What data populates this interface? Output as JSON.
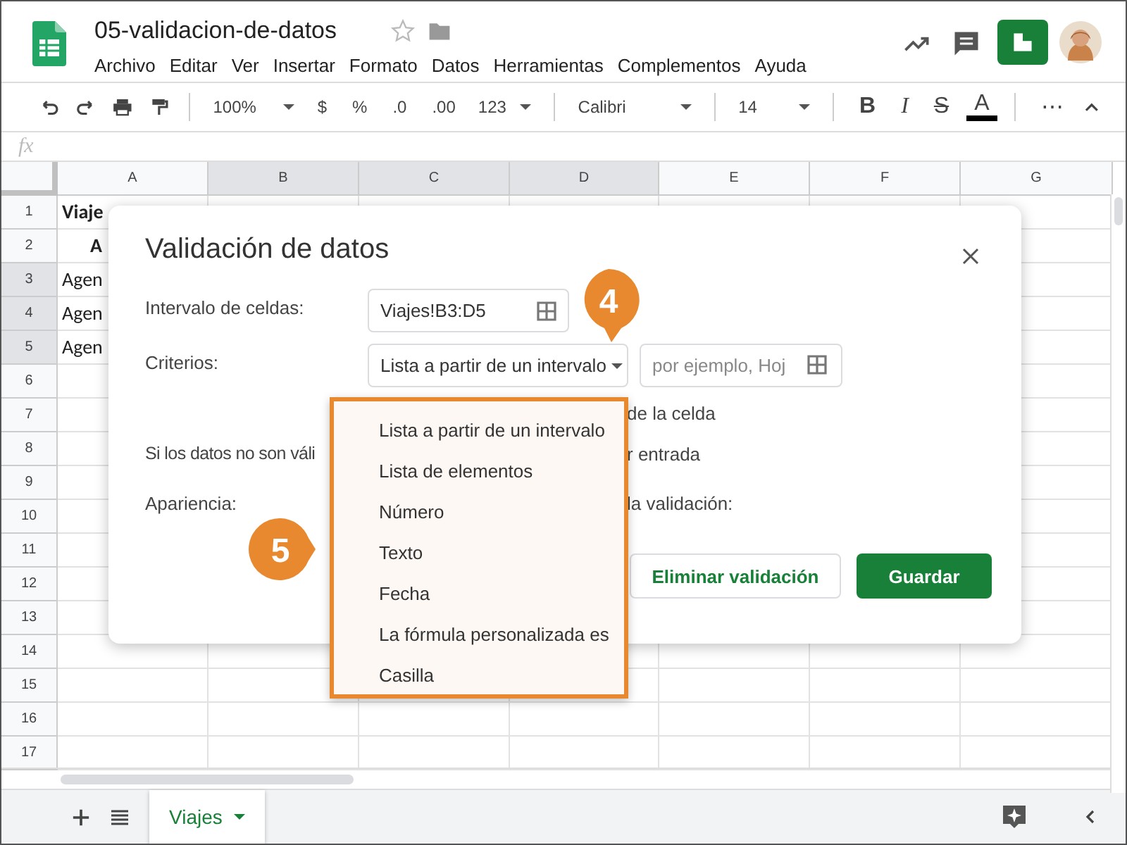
{
  "document": {
    "title": "05-validacion-de-datos"
  },
  "menu": [
    "Archivo",
    "Editar",
    "Ver",
    "Insertar",
    "Formato",
    "Datos",
    "Herramientas",
    "Complementos",
    "Ayuda"
  ],
  "toolbar": {
    "zoom": "100%",
    "currency": "$",
    "percent": "%",
    "decrease_decimals": ".0",
    "increase_decimals": ".00",
    "number_format": "123",
    "font": "Calibri",
    "font_size": "14",
    "bold": "B",
    "italic": "I",
    "strikethrough": "S",
    "text_color": "A",
    "more": "⋯"
  },
  "formula_bar": {
    "fx": "fx"
  },
  "columns": [
    {
      "label": "A",
      "selected": false
    },
    {
      "label": "B",
      "selected": true
    },
    {
      "label": "C",
      "selected": true
    },
    {
      "label": "D",
      "selected": true
    },
    {
      "label": "E",
      "selected": false
    },
    {
      "label": "F",
      "selected": false
    },
    {
      "label": "G",
      "selected": false
    }
  ],
  "rows": [
    {
      "number": "1",
      "selected": false,
      "cell_a": {
        "text": "Viaje",
        "kind": "title"
      }
    },
    {
      "number": "2",
      "selected": false,
      "cell_a": {
        "text": "A",
        "kind": "header"
      }
    },
    {
      "number": "3",
      "selected": true,
      "cell_a": {
        "text": "Agen",
        "kind": "data"
      }
    },
    {
      "number": "4",
      "selected": true,
      "cell_a": {
        "text": "Agen",
        "kind": "data"
      }
    },
    {
      "number": "5",
      "selected": true,
      "cell_a": {
        "text": "Agen",
        "kind": "data"
      }
    },
    {
      "number": "6",
      "selected": false
    },
    {
      "number": "7",
      "selected": false
    },
    {
      "number": "8",
      "selected": false
    },
    {
      "number": "9",
      "selected": false
    },
    {
      "number": "10",
      "selected": false
    },
    {
      "number": "11",
      "selected": false
    },
    {
      "number": "12",
      "selected": false
    },
    {
      "number": "13",
      "selected": false
    },
    {
      "number": "14",
      "selected": false
    },
    {
      "number": "15",
      "selected": false
    },
    {
      "number": "16",
      "selected": false
    },
    {
      "number": "17",
      "selected": false
    }
  ],
  "dialog": {
    "title": "Validación de datos",
    "range_label": "Intervalo de celdas:",
    "range_value": "Viajes!B3:D5",
    "criteria_label": "Criterios:",
    "criteria_value": "Lista a partir de un intervalo",
    "criteria_source_placeholder": "por ejemplo, Hoj",
    "show_list_fragment": "de la celda",
    "invalid_label": "Si los datos no son váli",
    "invalid_option_fragment": "r entrada",
    "appearance_label": "Apariencia:",
    "appearance_option_fragment": "la validación:",
    "buttons": [
      {
        "label": "Eliminar validación",
        "kind": "secondary"
      },
      {
        "label": "Guardar",
        "kind": "primary"
      }
    ]
  },
  "criteria_menu": [
    "Lista a partir de un intervalo",
    "Lista de elementos",
    "Número",
    "Texto",
    "Fecha",
    "La fórmula personalizada es",
    "Casilla"
  ],
  "callouts": [
    {
      "number": "4",
      "kind": "down"
    },
    {
      "number": "5",
      "kind": "right"
    }
  ],
  "sheet_tabs": [
    {
      "label": "Viajes",
      "selected": true
    }
  ]
}
